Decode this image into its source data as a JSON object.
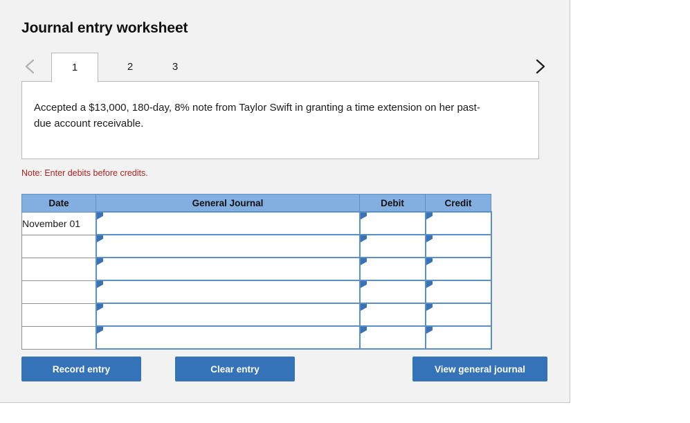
{
  "page": {
    "title": "Journal entry worksheet",
    "background_color": "#f2f2f2",
    "accent_color": "#3573b9",
    "header_color": "#82aee0",
    "note_color": "#b32020"
  },
  "pager": {
    "prev_icon": "chevron-left-icon",
    "next_icon": "chevron-right-icon",
    "prev_enabled": false,
    "next_enabled": true,
    "tabs": [
      {
        "label": "1",
        "active": true
      },
      {
        "label": "2",
        "active": false
      },
      {
        "label": "3",
        "active": false
      }
    ]
  },
  "description": {
    "text": "Accepted a $13,000, 180-day, 8% note from Taylor Swift in granting a time extension on her past-due account receivable."
  },
  "note": {
    "text": "Note: Enter debits before credits."
  },
  "journal": {
    "columns": [
      "Date",
      "General Journal",
      "Debit",
      "Credit"
    ],
    "rows": [
      {
        "date": "November 01",
        "general_journal": "",
        "debit": "",
        "credit": ""
      },
      {
        "date": "",
        "general_journal": "",
        "debit": "",
        "credit": ""
      },
      {
        "date": "",
        "general_journal": "",
        "debit": "",
        "credit": ""
      },
      {
        "date": "",
        "general_journal": "",
        "debit": "",
        "credit": ""
      },
      {
        "date": "",
        "general_journal": "",
        "debit": "",
        "credit": ""
      },
      {
        "date": "",
        "general_journal": "",
        "debit": "",
        "credit": ""
      }
    ]
  },
  "buttons": {
    "record": "Record entry",
    "clear": "Clear entry",
    "view": "View general journal"
  }
}
